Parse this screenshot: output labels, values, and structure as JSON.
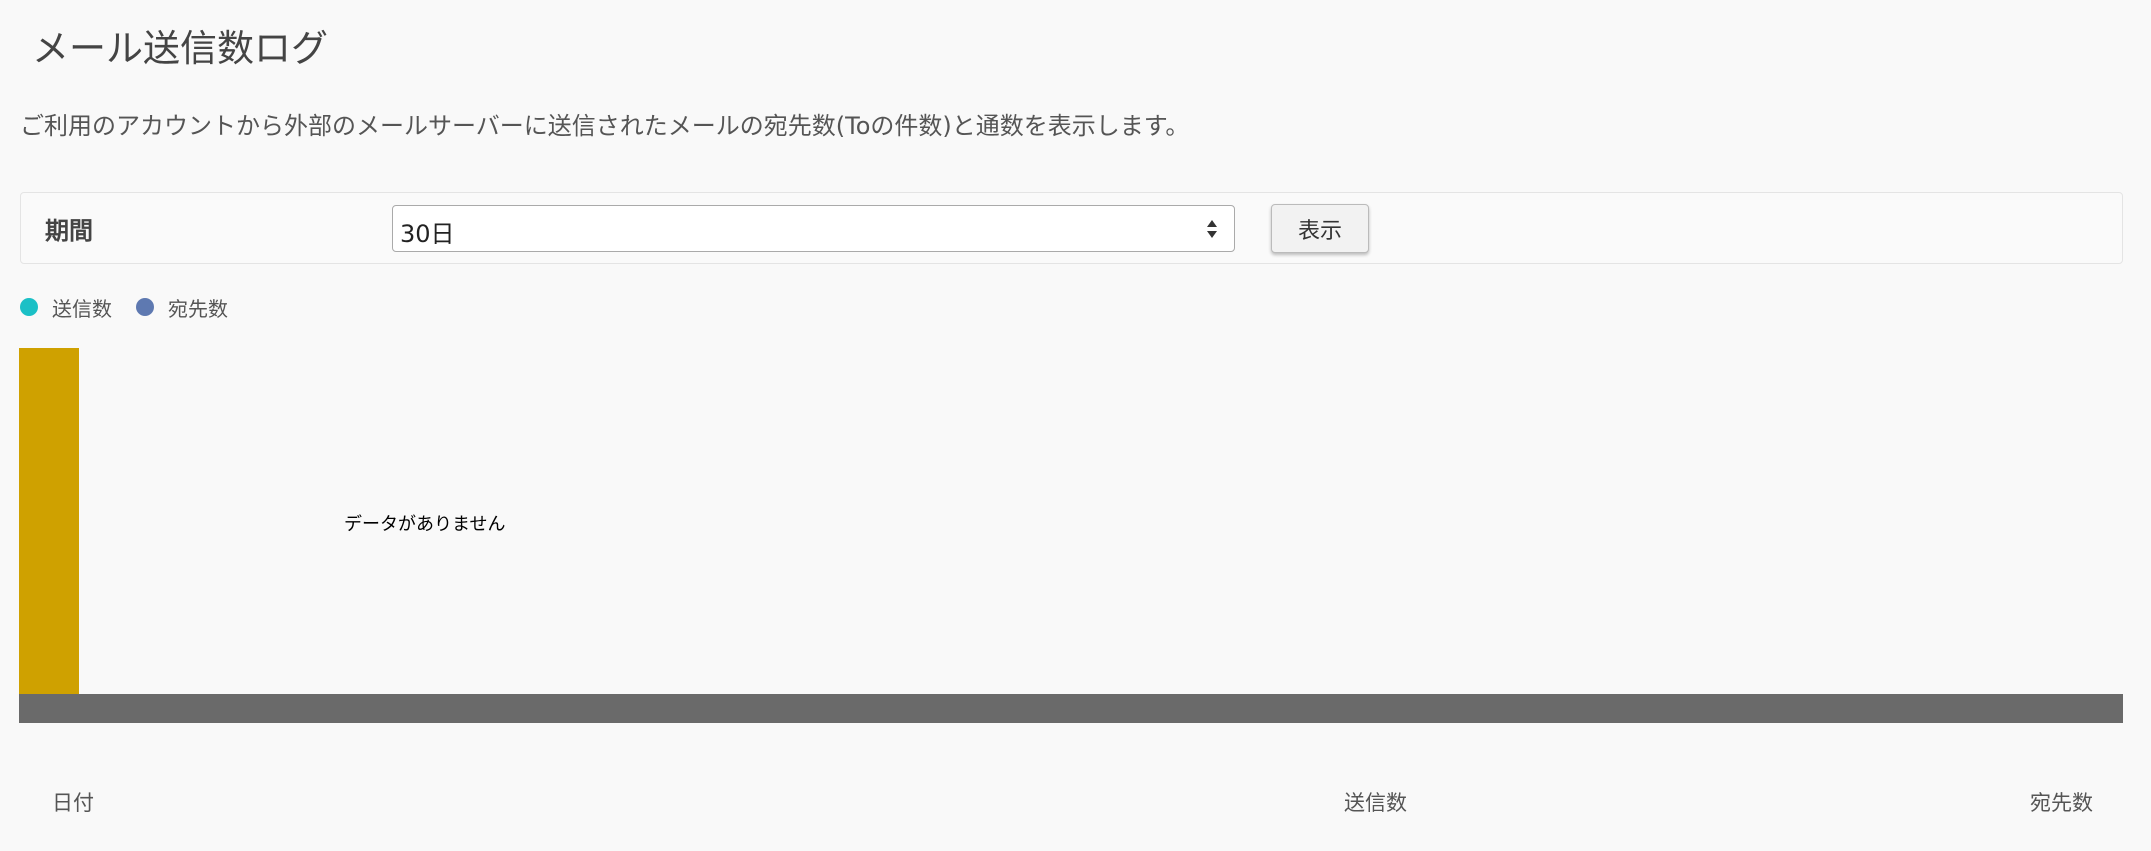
{
  "page": {
    "title": "メール送信数ログ",
    "description": "ご利用のアカウントから外部のメールサーバーに送信されたメールの宛先数(Toの件数)と通数を表示します。"
  },
  "filter": {
    "label": "期間",
    "period_value": "30日",
    "submit_label": "表示"
  },
  "legend": {
    "items": [
      {
        "label": "送信数",
        "color": "#1bc0c6"
      },
      {
        "label": "宛先数",
        "color": "#5e79b1"
      }
    ]
  },
  "chart": {
    "bar_color": "#cfa100",
    "footer_color": "#6a6a6a",
    "no_data_text": "データがありません"
  },
  "table": {
    "headers": [
      "日付",
      "送信数",
      "宛先数"
    ]
  },
  "icons": {
    "select_arrows": "sort-arrows-icon"
  }
}
